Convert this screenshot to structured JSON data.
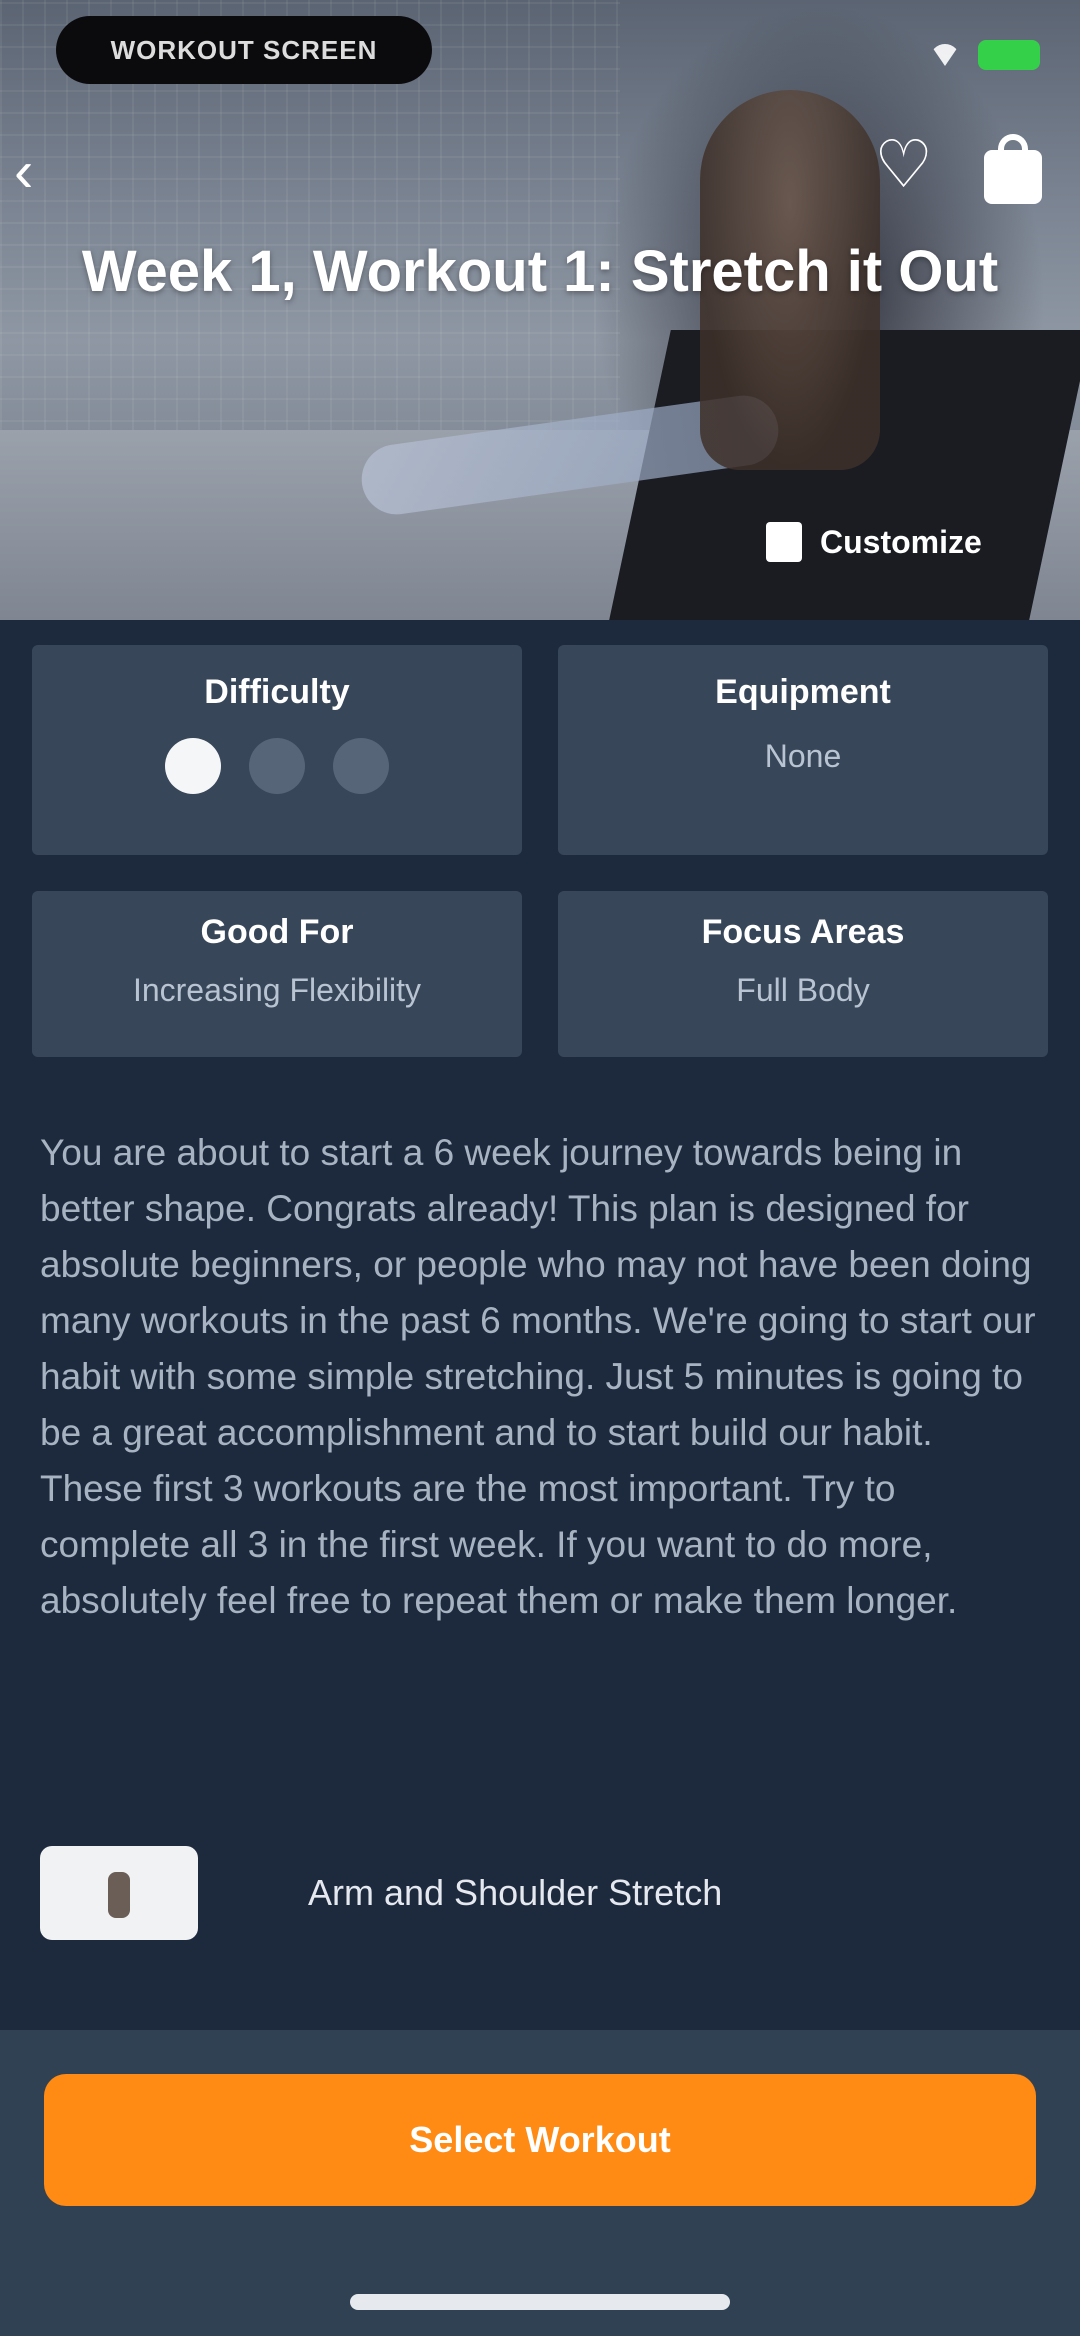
{
  "status_bar": {
    "pill_text": "WORKOUT SCREEN",
    "battery_color": "#35d04a"
  },
  "header": {
    "title": "Week 1, Workout 1: Stretch it Out",
    "customize_label": "Customize"
  },
  "info_cards": [
    {
      "label": "Difficulty",
      "level": 1,
      "max": 3
    },
    {
      "label": "Equipment",
      "value": "None"
    },
    {
      "label": "Good For",
      "value": "Increasing Flexibility"
    },
    {
      "label": "Focus Areas",
      "value": "Full Body"
    }
  ],
  "description": "You are about to start a 6 week journey towards being in better shape. Congrats already! This plan is designed for absolute beginners, or people who may not have been doing many workouts in the past 6 months. We're going to start our habit with some simple stretching. Just 5 minutes is going to be a great accomplishment and to start build our habit. These first 3 workouts are the most important. Try to complete all 3 in the first week. If you want to do more, absolutely feel free to repeat them or make them longer.",
  "exercises": [
    {
      "name": "Arm and Shoulder Stretch"
    }
  ],
  "cta": {
    "label": "Select Workout",
    "color": "#ff8a14"
  }
}
